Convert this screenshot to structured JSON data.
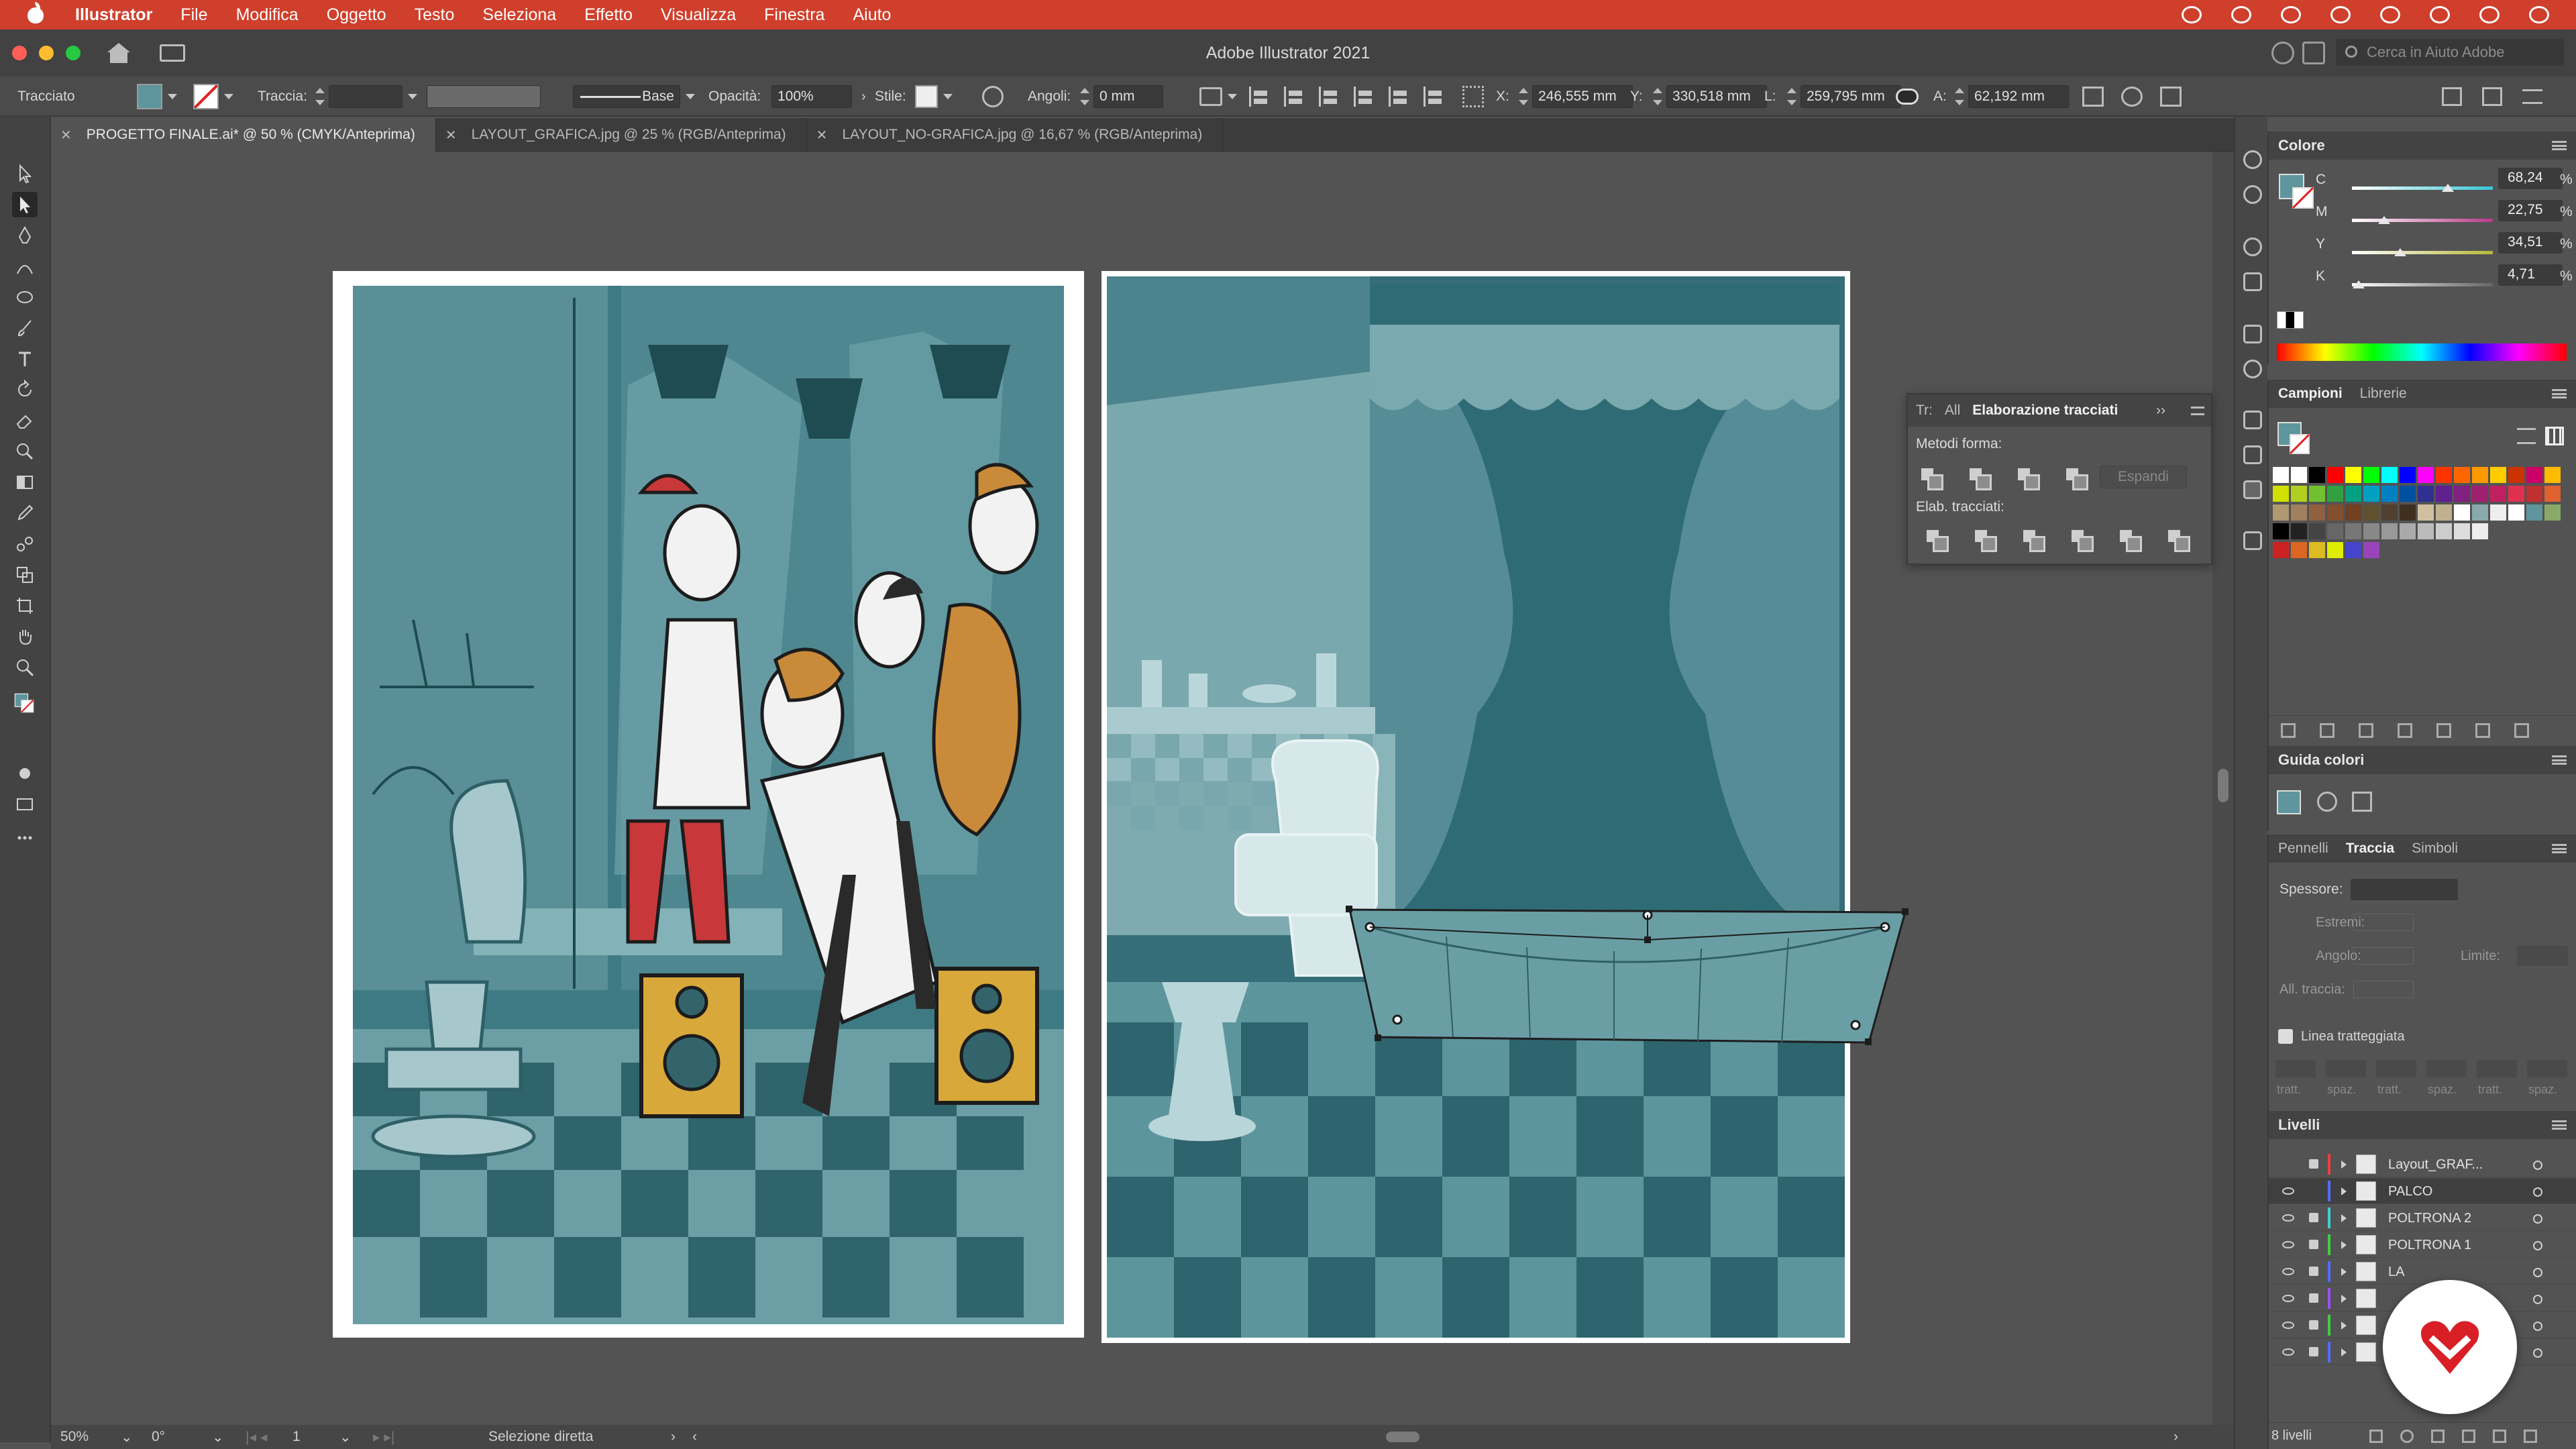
{
  "menubar": {
    "app": "Illustrator",
    "items": [
      "File",
      "Modifica",
      "Oggetto",
      "Testo",
      "Seleziona",
      "Effetto",
      "Visualizza",
      "Finestra",
      "Aiuto"
    ]
  },
  "titlebar": {
    "title": "Adobe Illustrator 2021",
    "search_placeholder": "Cerca in Aiuto Adobe"
  },
  "controlbar": {
    "selection_type": "Tracciato",
    "stroke_label": "Traccia:",
    "stroke_profile": "Base",
    "opacity_label": "Opacità:",
    "opacity_value": "100%",
    "style_label": "Stile:",
    "corners_label": "Angoli:",
    "corners_value": "0 mm",
    "x_label": "X:",
    "x_value": "246,555 mm",
    "y_label": "Y:",
    "y_value": "330,518 mm",
    "w_label": "L:",
    "w_value": "259,795 mm",
    "h_label": "A:",
    "h_value": "62,192 mm"
  },
  "tabs": [
    {
      "label": "PROGETTO FINALE.ai* @ 50 % (CMYK/Anteprima)",
      "active": true
    },
    {
      "label": "LAYOUT_GRAFICA.jpg @ 25 % (RGB/Anteprima)",
      "active": false
    },
    {
      "label": "LAYOUT_NO-GRAFICA.jpg @ 16,67 % (RGB/Anteprima)",
      "active": false
    }
  ],
  "statusbar": {
    "zoom": "50%",
    "rotation": "0°",
    "artboard": "1",
    "tool": "Selezione diretta"
  },
  "color_panel": {
    "title": "Colore",
    "channels": [
      {
        "name": "C",
        "value": "68,24",
        "fraction": 0.6824,
        "track": "#36c6d8"
      },
      {
        "name": "M",
        "value": "22,75",
        "fraction": 0.2275,
        "track": "#b83a87"
      },
      {
        "name": "Y",
        "value": "34,51",
        "fraction": 0.3451,
        "track": "#b8b83a"
      },
      {
        "name": "K",
        "value": "4,71",
        "fraction": 0.0471,
        "track": "#666666"
      }
    ],
    "unit": "%"
  },
  "swatches_panel": {
    "tabs": [
      "Campioni",
      "Librerie"
    ]
  },
  "color_guide": {
    "title": "Guida colori"
  },
  "stroke_panel": {
    "tabs": [
      "Pennelli",
      "Traccia",
      "Simboli"
    ],
    "weight_label": "Spessore:",
    "caps_label": "Estremi:",
    "corner_label": "Angolo:",
    "limit_label": "Limite:",
    "align_label": "All. traccia:",
    "dashed_label": "Linea tratteggiata",
    "dash_labels": [
      "tratt.",
      "spaz.",
      "tratt.",
      "spaz.",
      "tratt.",
      "spaz."
    ]
  },
  "pathfinder": {
    "tabs": [
      "Tr:",
      "All"
    ],
    "active_tab": "Elaborazione tracciati",
    "shape_modes_label": "Metodi forma:",
    "pathfinders_label": "Elab. tracciati:",
    "expand_label": "Espandi"
  },
  "layers_panel": {
    "title": "Livelli",
    "count_label": "8 livelli",
    "layers": [
      {
        "name": "Layout_GRAF...",
        "color": "#ef3f3f",
        "selected": false
      },
      {
        "name": "PALCO",
        "color": "#4f6fff",
        "selected": true
      },
      {
        "name": "POLTRONA 2",
        "color": "#3fcfcf",
        "selected": false
      },
      {
        "name": "POLTRONA 1",
        "color": "#3fcf3f",
        "selected": false
      },
      {
        "name": "LA",
        "color": "#4f6fff",
        "selected": false
      },
      {
        "name": "",
        "color": "#9f4fff",
        "selected": false
      },
      {
        "name": "",
        "color": "#3fcf3f",
        "selected": false
      },
      {
        "name": "",
        "color": "#4f6fff",
        "selected": false
      }
    ]
  },
  "colors": {
    "accent_red": "#cf3f2c",
    "teal_dark": "#356e78",
    "teal_mid": "#5f959d",
    "teal_light": "#a7c9cd"
  }
}
